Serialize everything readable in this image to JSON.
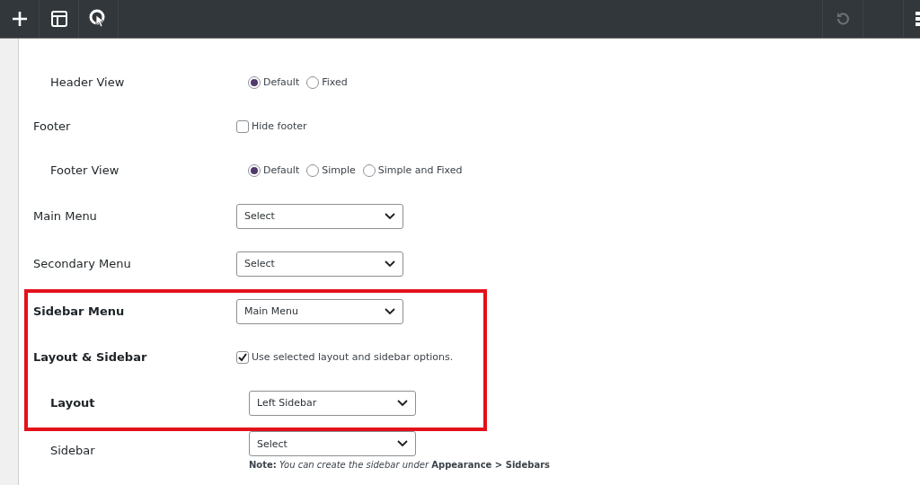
{
  "toolbar": {
    "tools": [
      {
        "kind": "add"
      },
      {
        "kind": "layout"
      },
      {
        "kind": "target"
      }
    ],
    "undo": {
      "disabled": true
    }
  },
  "settings": [
    {
      "kind": "radio",
      "label": "Header View",
      "indented": true,
      "highlighted": false,
      "options": [
        {
          "label": "Default",
          "selected": true
        },
        {
          "label": "Fixed",
          "selected": false
        }
      ]
    },
    {
      "kind": "checkbox",
      "label": "Footer",
      "indented": false,
      "highlighted": false,
      "option": {
        "label": "Hide footer",
        "checked": false
      }
    },
    {
      "kind": "radio",
      "label": "Footer View",
      "indented": true,
      "highlighted": false,
      "options": [
        {
          "label": "Default",
          "selected": true
        },
        {
          "label": "Simple",
          "selected": false
        },
        {
          "label": "Simple and Fixed",
          "selected": false
        }
      ]
    },
    {
      "kind": "select",
      "label": "Main Menu",
      "indented": false,
      "highlighted": false,
      "value": "Select"
    },
    {
      "kind": "select",
      "label": "Secondary Menu",
      "indented": false,
      "highlighted": false,
      "value": "Select"
    },
    {
      "kind": "select",
      "label": "Sidebar Menu",
      "indented": false,
      "highlighted": true,
      "value": "Main Menu"
    },
    {
      "kind": "checkbox",
      "label": "Layout & Sidebar",
      "indented": false,
      "highlighted": true,
      "option": {
        "label": "Use selected layout and sidebar options.",
        "checked": true
      }
    },
    {
      "kind": "select",
      "label": "Layout",
      "indented": true,
      "highlighted": true,
      "value": "Left Sidebar"
    },
    {
      "kind": "select",
      "label": "Sidebar",
      "indented": true,
      "highlighted": false,
      "value": "Select",
      "note": "**Note:** *You can create the sidebar under* **Appearance > Sidebars**"
    }
  ]
}
